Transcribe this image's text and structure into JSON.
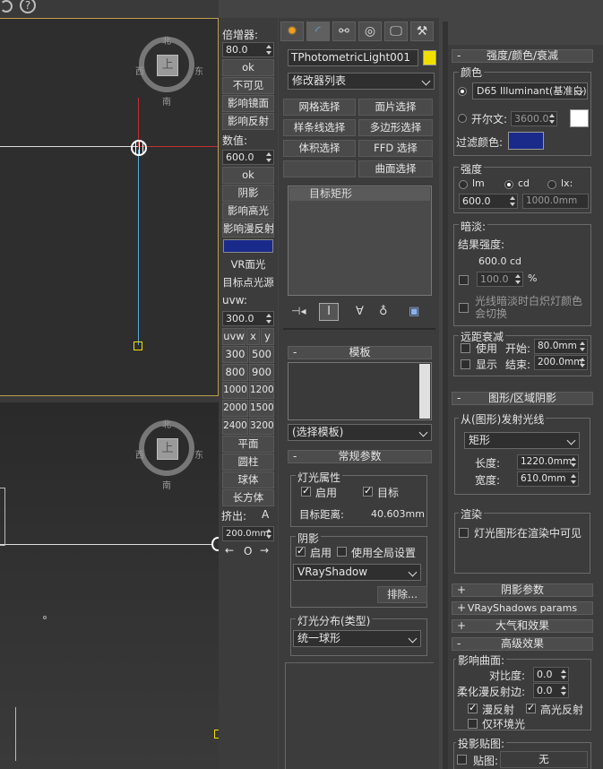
{
  "toolbar_top": {
    "icon1": "circle-icon",
    "icon2": "help-icon"
  },
  "viewport_top": {
    "compass": {
      "n": "北",
      "s": "南",
      "w": "西",
      "e": "东",
      "center": "上"
    }
  },
  "viewport_bottom": {
    "compass": {
      "n": "北",
      "s": "南",
      "w": "西",
      "e": "东",
      "center": "上"
    }
  },
  "midbar": {
    "multiplier_label": "倍增器:",
    "multiplier_value": "80.0",
    "ok1": "ok",
    "invisible": "不可见",
    "affect_reflections_mirror": "影响镜面",
    "affect_reflections": "影响反射",
    "value_label": "数值:",
    "value_value": "600.0",
    "ok2": "ok",
    "shadow": "阴影",
    "affect_specular": "影响高光",
    "affect_diffuse": "影响漫反射",
    "vr_plane": "VR面光",
    "target_point_light": "目标点光源",
    "uvw_label": "uvw:",
    "uvw_value": "300.0",
    "uvw_btn": "uvw",
    "x_btn": "x",
    "y_btn": "y",
    "sizes": [
      [
        "300",
        "500"
      ],
      [
        "800",
        "900"
      ],
      [
        "1000",
        "1200"
      ],
      [
        "2000",
        "1500"
      ],
      [
        "2400",
        "3200"
      ]
    ],
    "plane": "平面",
    "cylinder": "圆柱",
    "sphere": "球体",
    "box": "长方体",
    "extrude_label": "挤出:",
    "extrude_a": "A",
    "extrude_value": "200.0mm",
    "arrow_left": "←",
    "arrow_o": "O",
    "arrow_right": "→",
    "swatch_color": "#1a2a8a"
  },
  "cmdpanel": {
    "tabs": [
      "create-icon",
      "modify-icon",
      "hierarchy-icon",
      "motion-icon",
      "display-icon",
      "utilities-icon"
    ],
    "object_name": "TPhotometricLight001",
    "object_color": "#f0e000",
    "modifier_list": "修改器列表",
    "sel_buttons": [
      [
        "网格选择",
        "面片选择"
      ],
      [
        "样条线选择",
        "多边形选择"
      ],
      [
        "体积选择",
        "FFD 选择"
      ],
      [
        "",
        "曲面选择"
      ]
    ],
    "stack_item": "目标矩形",
    "template_title": "模板",
    "template_select": "(选择模板)",
    "general_title": "常规参数",
    "light_props": "灯光属性",
    "enable": "启用",
    "target": "目标",
    "target_dist_label": "目标距离:",
    "target_dist_value": "40.603mm",
    "shadow_group": "阴影",
    "shadow_enable": "启用",
    "use_global": "使用全局设置",
    "shadow_type": "VRayShadow",
    "exclude_btn": "排除...",
    "distribution_group": "灯光分布(类型)",
    "distribution_value": "统一球形"
  },
  "rpanel": {
    "intensity_title": "强度/颜色/衰减",
    "color_group": "颜色",
    "color_preset": "D65 Illuminant(基准白)",
    "kelvin_label": "开尔文:",
    "kelvin_value": "3600.0",
    "filter_label": "过滤颜色:",
    "filter_color": "#1a2a8a",
    "intensity_group": "强度",
    "unit_lm": "lm",
    "unit_cd": "cd",
    "unit_lx": "lx:",
    "intensity_value": "600.0",
    "lx_value": "1000.0mm",
    "dimming_group": "暗淡:",
    "result_label": "结果强度:",
    "result_value": "600.0 cd",
    "percent_value": "100.0",
    "percent_sign": "%",
    "incandescent": "光线暗淡时白炽灯颜色会切换",
    "far_atten_group": "远距衰减",
    "use_label": "使用",
    "start_label": "开始:",
    "start_value": "80.0mm",
    "show_label": "显示",
    "end_label": "结束:",
    "end_value": "200.0mm",
    "shape_title": "图形/区域阴影",
    "emit_group": "从(图形)发射光线",
    "shape_value": "矩形",
    "length_label": "长度:",
    "length_value": "1220.0mm",
    "width_label": "宽度:",
    "width_value": "610.0mm",
    "render_group": "渲染",
    "render_visible": "灯光图形在渲染中可见",
    "shadow_params": "阴影参数",
    "vray_shadow_params": "VRayShadows params",
    "atmos": "大气和效果",
    "advanced": "高级效果",
    "affect_surfaces": "影响曲面:",
    "contrast_label": "对比度:",
    "contrast_value": "0.0",
    "soften_label": "柔化漫反射边:",
    "soften_value": "0.0",
    "diffuse": "漫反射",
    "specular": "高光反射",
    "ambient_only": "仅环境光",
    "projector": "投影贴图:",
    "map_label": "贴图:",
    "map_none": "无"
  }
}
